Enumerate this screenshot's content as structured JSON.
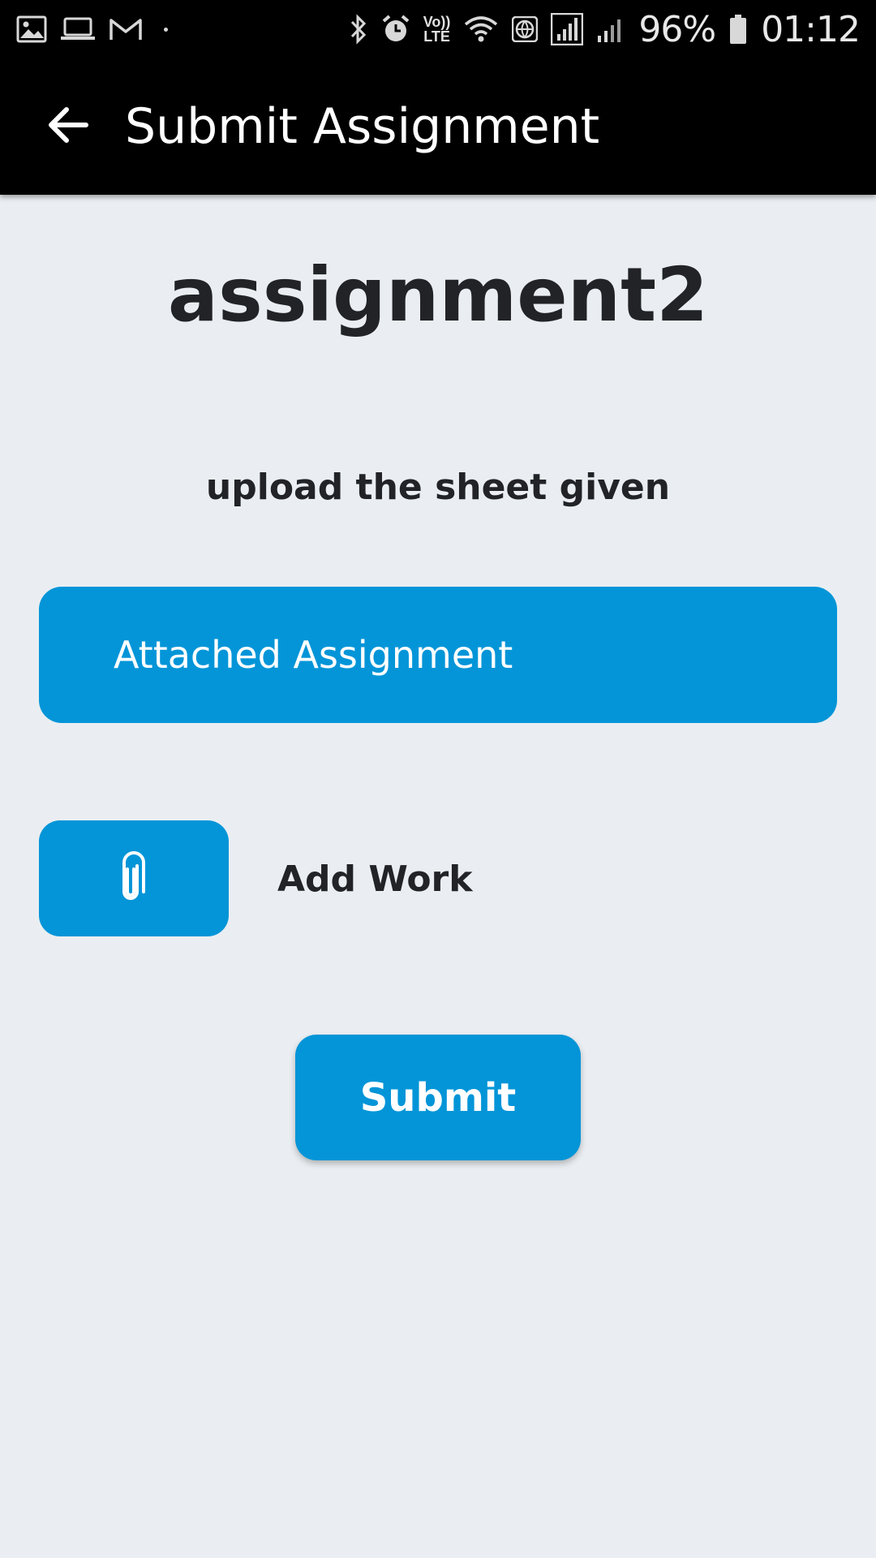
{
  "status_bar": {
    "battery_text": "96%",
    "time": "01:12",
    "volte_top": "Vo))",
    "volte_bottom": "LTE",
    "left_icons": [
      "gallery-icon",
      "laptop-icon",
      "gmail-icon",
      "dot-icon"
    ],
    "right_icons": [
      "bluetooth-icon",
      "alarm-icon",
      "volte-icon",
      "wifi-icon",
      "globe-icon",
      "signal-icon",
      "signal-icon",
      "battery-icon"
    ]
  },
  "app_bar": {
    "title": "Submit Assignment",
    "back_icon": "arrow-back-icon"
  },
  "assignment": {
    "name": "assignment2",
    "description": "upload the sheet given"
  },
  "buttons": {
    "attached_label": "Attached Assignment",
    "attach_icon": "paperclip-icon",
    "add_work_label": "Add Work",
    "submit_label": "Submit"
  },
  "colors": {
    "accent": "#0395d8",
    "background": "#eaeef2",
    "appbar": "#000000",
    "text": "#212326"
  }
}
